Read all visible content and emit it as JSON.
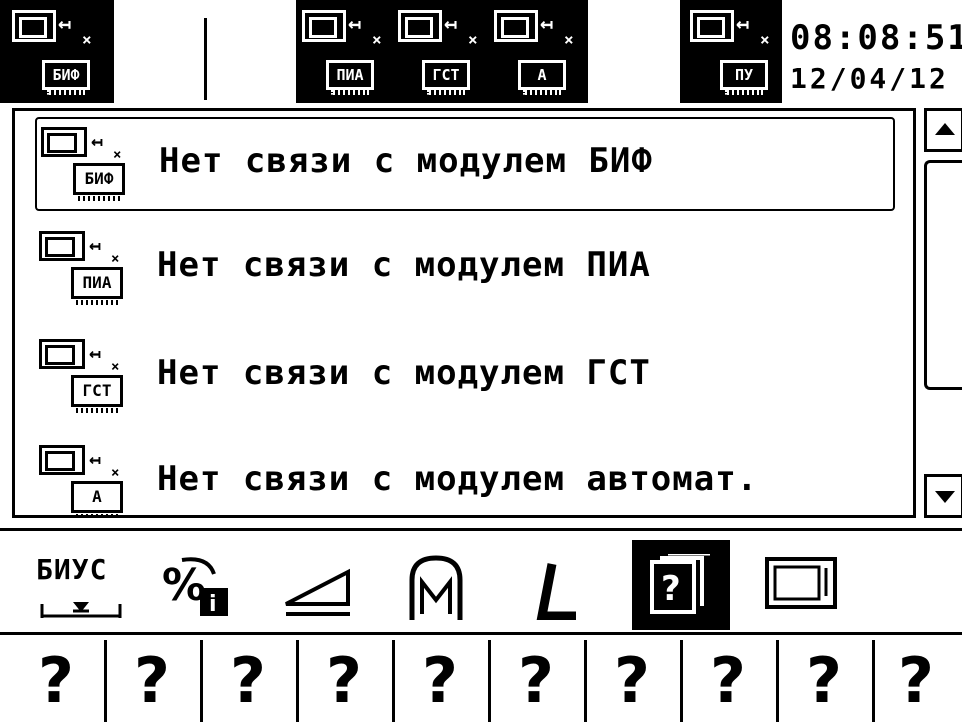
{
  "status_bar": {
    "modules": [
      {
        "label": "БИФ"
      },
      {
        "label": "ПИА"
      },
      {
        "label": "ГСТ"
      },
      {
        "label": "А"
      },
      {
        "label": "ПУ"
      }
    ],
    "time": "08:08:51",
    "date": "12/04/12"
  },
  "messages": [
    {
      "icon_label": "БИФ",
      "text": "Нет связи с модулем БИФ",
      "selected": true
    },
    {
      "icon_label": "ПИА",
      "text": "Нет связи с модулем ПИА",
      "selected": false
    },
    {
      "icon_label": "ГСТ",
      "text": "Нет связи с модулем ГСТ",
      "selected": false
    },
    {
      "icon_label": "А",
      "text": "Нет связи с модулем автомат.",
      "selected": false
    }
  ],
  "toolbar": {
    "biu_label": "БИУС",
    "items": [
      "biu-scale-icon",
      "no-info-icon",
      "slope-icon",
      "motor-icon",
      "angle-icon",
      "help-pages-icon",
      "monitor-icon"
    ],
    "active": "help-pages-icon"
  },
  "softkeys": [
    "?",
    "?",
    "?",
    "?",
    "?",
    "?",
    "?",
    "?",
    "?",
    "?"
  ]
}
